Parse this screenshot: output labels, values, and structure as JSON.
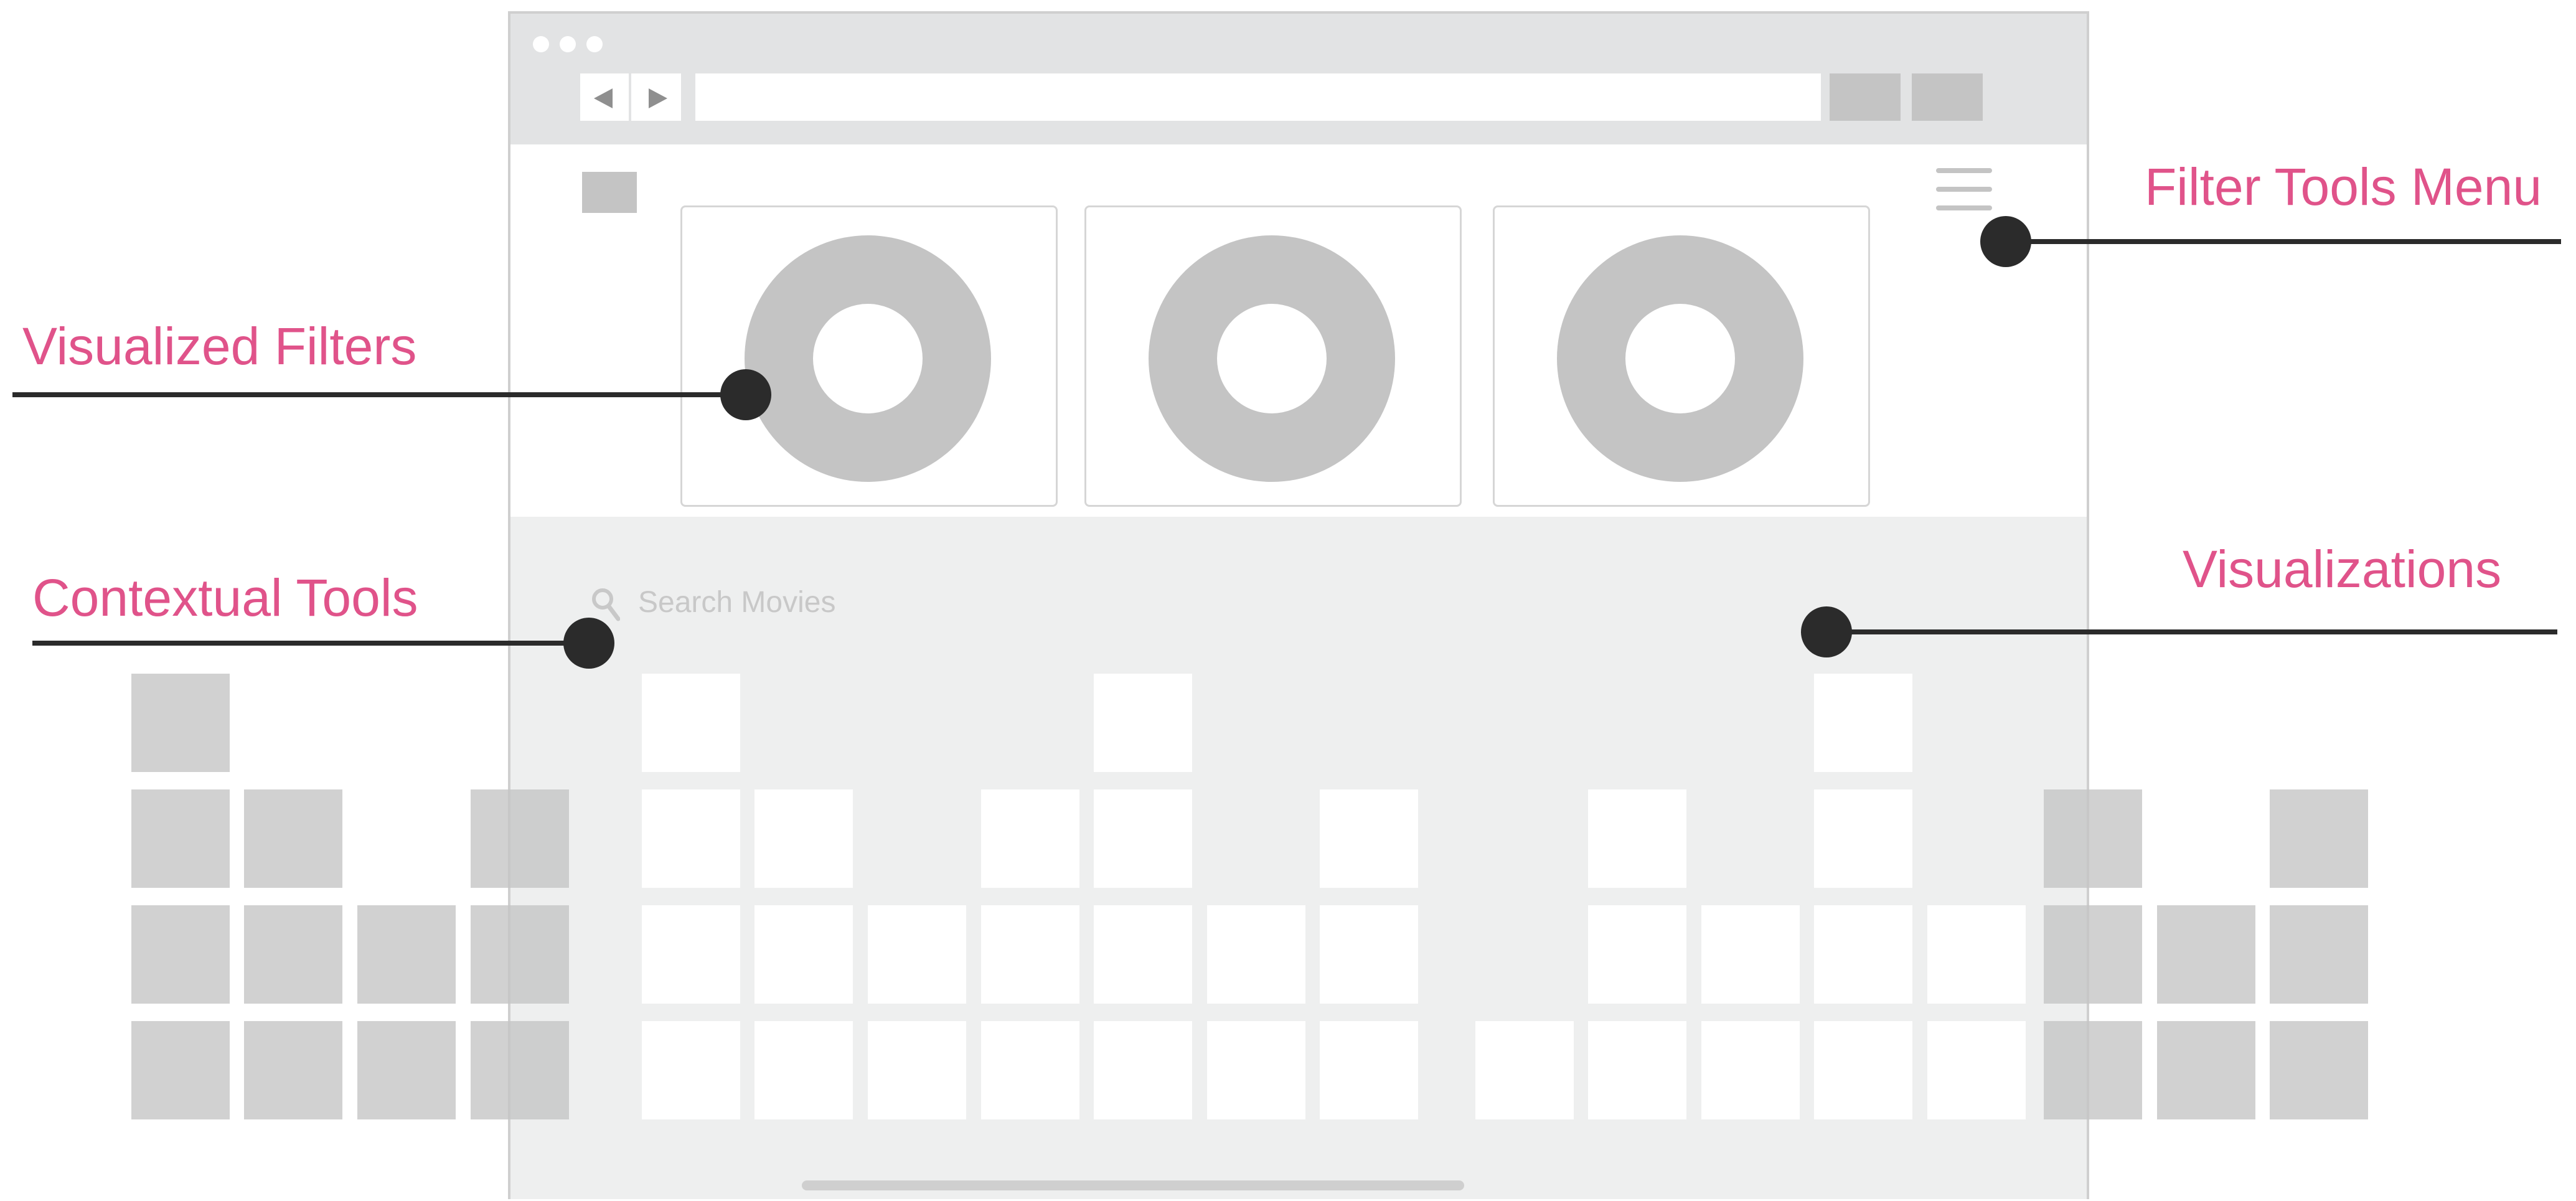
{
  "annotations": {
    "filter_tools_menu": "Filter Tools Menu",
    "visualized_filters": "Visualized Filters",
    "contextual_tools": "Contextual Tools",
    "visualizations": "Visualizations"
  },
  "search": {
    "placeholder": "Search Movies",
    "icon": "search-icon"
  },
  "header": {
    "filter_cards": [
      "donut-filter-1",
      "donut-filter-2",
      "donut-filter-3"
    ],
    "menu_icon": "hamburger-icon"
  },
  "colors": {
    "accent": "#e0538a",
    "marker": "#2b2b2b",
    "placeholder_gray": "#c4c4c4",
    "chrome_gray": "#e2e3e4",
    "content_bg": "#eeefef"
  }
}
